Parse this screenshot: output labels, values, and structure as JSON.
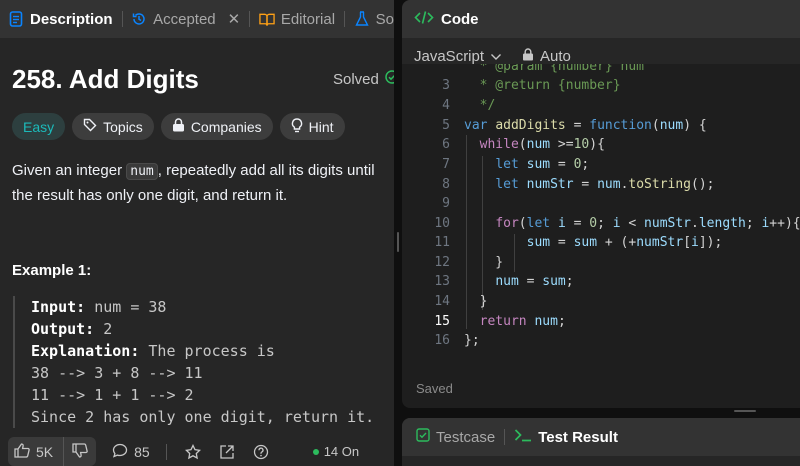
{
  "left_tabs": [
    {
      "label": "Description",
      "icon": "document-icon",
      "active": true
    },
    {
      "label": "Accepted",
      "icon": "history-icon",
      "active": false
    },
    {
      "label": "Editorial",
      "icon": "book-icon",
      "active": false
    },
    {
      "label": "So",
      "icon": "flask-icon",
      "active": false
    }
  ],
  "problem": {
    "title": "258. Add Digits",
    "status": "Solved",
    "difficulty": "Easy",
    "chips": [
      "Topics",
      "Companies",
      "Hint"
    ],
    "description_parts": [
      "Given an integer ",
      "num",
      ", repeatedly add all its digits until the result has only one digit, and return it."
    ]
  },
  "example": {
    "title": "Example 1:",
    "input_label": "Input:",
    "input_value": " num = 38",
    "output_label": "Output:",
    "output_value": " 2",
    "explanation_label": "Explanation:",
    "explanation_value": " The process is",
    "lines": [
      "38 --> 3 + 8 --> 11",
      "11 --> 1 + 1 --> 2",
      "Since 2 has only one digit, return it."
    ]
  },
  "bottom_bar": {
    "likes": "5K",
    "comments": "85",
    "online": "14 On"
  },
  "code_panel": {
    "title": "Code",
    "language": "JavaScript",
    "mode": "Auto",
    "status": "Saved",
    "current_line": "15",
    "line_numbers": [
      "",
      "3",
      "4",
      "5",
      "6",
      "7",
      "8",
      "9",
      "10",
      "11",
      "12",
      "13",
      "14",
      "15",
      "16"
    ]
  },
  "bottom_panel": {
    "tabs": [
      {
        "label": "Testcase",
        "active": false
      },
      {
        "label": "Test Result",
        "active": true
      }
    ]
  },
  "colors": {
    "accent_green": "#2cbb5d",
    "easy": "#1cbaba",
    "link_blue": "#0a84ff",
    "editorial_orange": "#ffa116"
  }
}
